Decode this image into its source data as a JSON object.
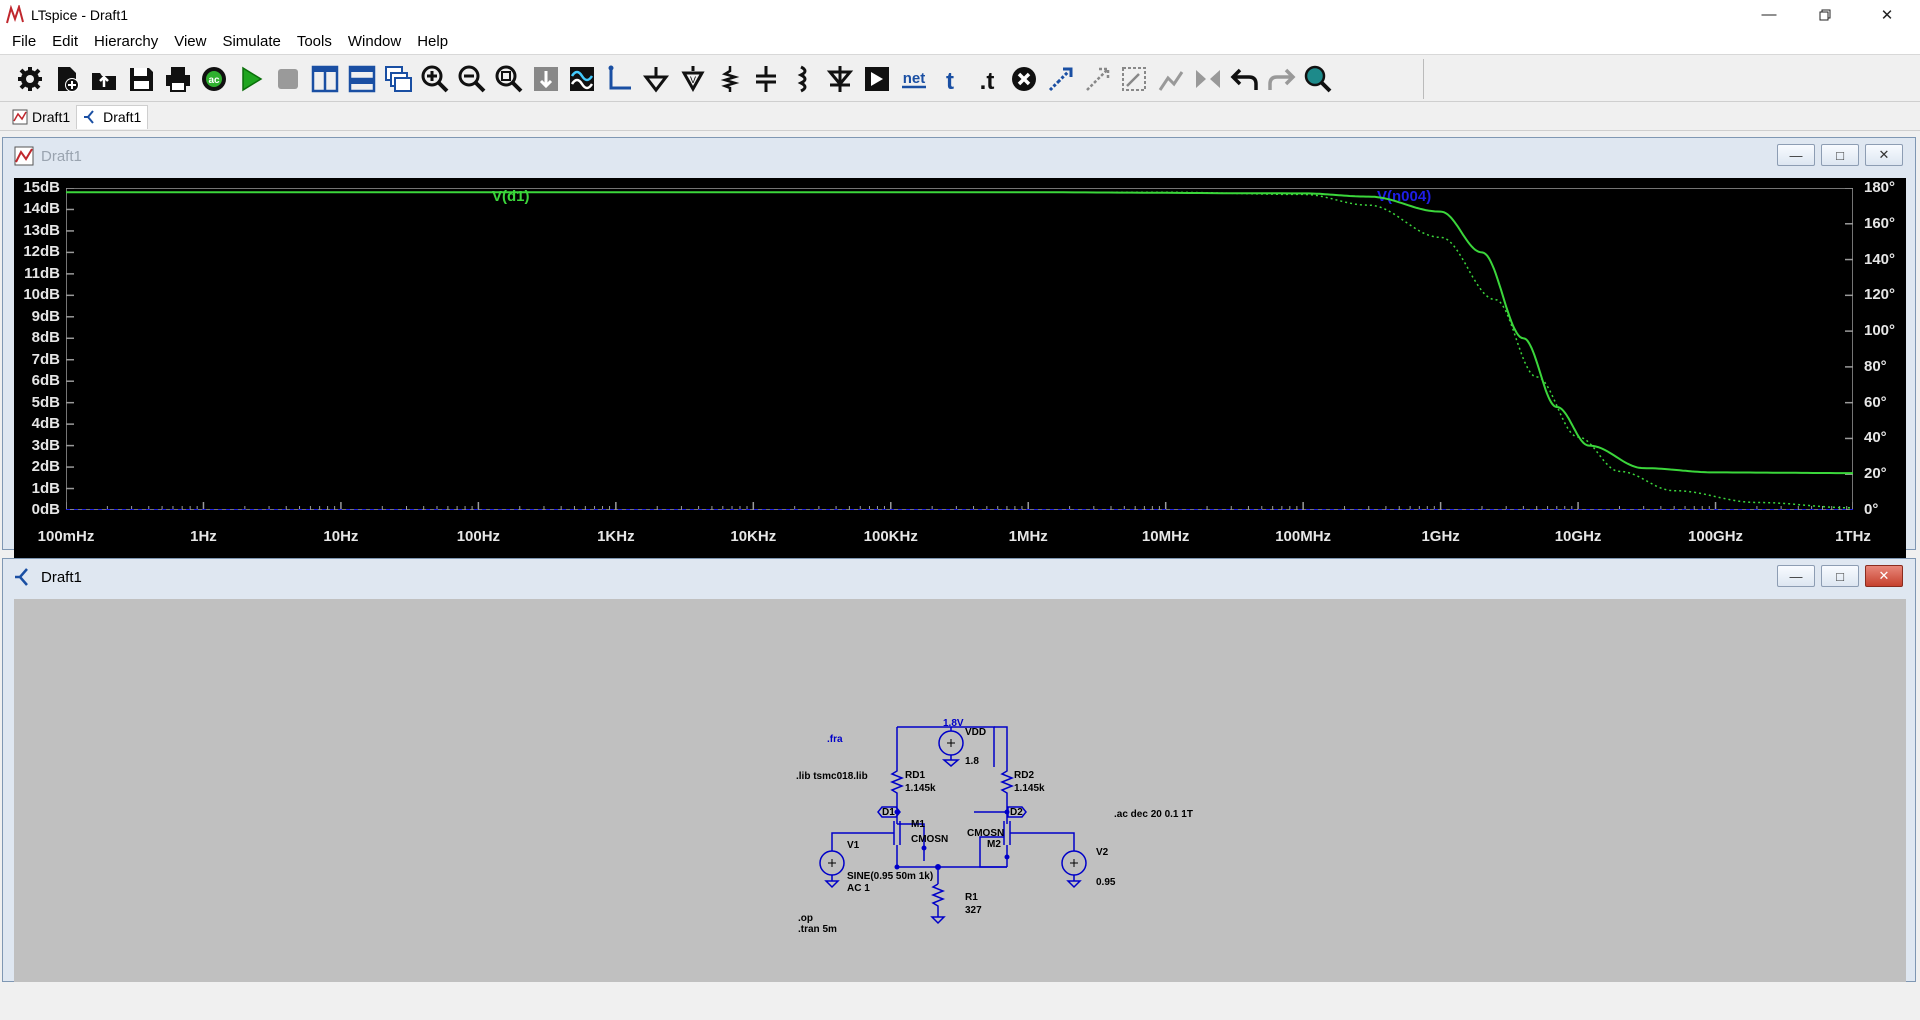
{
  "window": {
    "title": "LTspice - Draft1"
  },
  "menu": [
    "File",
    "Edit",
    "Hierarchy",
    "View",
    "Simulate",
    "Tools",
    "Window",
    "Help"
  ],
  "toolbar": {
    "icons": [
      "settings-icon",
      "new-schematic-icon",
      "open-icon",
      "save-icon",
      "print-icon",
      "control-panel-icon",
      "run-icon",
      "halt-icon",
      "tile-vertical-icon",
      "tile-horizontal-icon",
      "cascade-icon",
      "zoom-in-icon",
      "zoom-out-icon",
      "zoom-fit-icon",
      "autorange-icon",
      "waveform-icon",
      "wire-icon",
      "ground-icon",
      "label-net-icon",
      "resistor-icon",
      "capacitor-icon",
      "inductor-icon",
      "diode-icon",
      "component-icon",
      "net-label-icon",
      "text-icon",
      "spice-directive-icon",
      "delete-icon",
      "duplicate-icon",
      "move-icon",
      "drag-icon",
      "rotate-icon",
      "mirror-icon",
      "undo-icon",
      "redo-icon",
      "find-icon"
    ],
    "net_text": "net",
    "t_text": "t",
    "dot_t_text": ".t",
    "ac_text": "ac"
  },
  "tabs": [
    {
      "label": "Draft1",
      "kind": "waveform"
    },
    {
      "label": "Draft1",
      "kind": "schematic"
    }
  ],
  "waveform_window": {
    "title": "Draft1",
    "trace1": {
      "label": "V(d1)",
      "color": "#3bd63b"
    },
    "trace2": {
      "label": "V(n004)",
      "color": "#1e1ee6"
    }
  },
  "chart_data": {
    "type": "line",
    "x_scale": "log",
    "x_ticks": [
      "100mHz",
      "1Hz",
      "10Hz",
      "100Hz",
      "1KHz",
      "10KHz",
      "100KHz",
      "1MHz",
      "10MHz",
      "100MHz",
      "1GHz",
      "10GHz",
      "100GHz",
      "1THz"
    ],
    "y_left_ticks": [
      "15dB",
      "14dB",
      "13dB",
      "12dB",
      "11dB",
      "10dB",
      "9dB",
      "8dB",
      "7dB",
      "6dB",
      "5dB",
      "4dB",
      "3dB",
      "2dB",
      "1dB",
      "0dB"
    ],
    "y_right_ticks": [
      "180°",
      "160°",
      "140°",
      "120°",
      "100°",
      "80°",
      "60°",
      "40°",
      "20°",
      "0°"
    ],
    "ylim_left": [
      0,
      15
    ],
    "ylim_right": [
      0,
      180
    ],
    "xlim_hz": [
      0.1,
      1000000000000.0
    ],
    "series": [
      {
        "name": "V(d1)",
        "kind": "magnitude_db",
        "points": [
          [
            0.1,
            14.8
          ],
          [
            1000000.0,
            14.8
          ],
          [
            100000000.0,
            14.75
          ],
          [
            300000000.0,
            14.6
          ],
          [
            1000000000.0,
            13.9
          ],
          [
            2000000000.0,
            12.0
          ],
          [
            4000000000.0,
            8.0
          ],
          [
            7000000000.0,
            4.8
          ],
          [
            12000000000.0,
            3.0
          ],
          [
            30000000000.0,
            1.95
          ],
          [
            100000000000.0,
            1.75
          ],
          [
            1000000000000.0,
            1.72
          ]
        ]
      },
      {
        "name": "V(d1)",
        "kind": "phase_dotted",
        "points": [
          [
            0.1,
            14.8
          ],
          [
            10000000.0,
            14.8
          ],
          [
            100000000.0,
            14.7
          ],
          [
            300000000.0,
            14.2
          ],
          [
            1000000000.0,
            12.7
          ],
          [
            2500000000.0,
            9.8
          ],
          [
            5000000000.0,
            6.2
          ],
          [
            10000000000.0,
            3.4
          ],
          [
            20000000000.0,
            1.8
          ],
          [
            50000000000.0,
            0.9
          ],
          [
            200000000000.0,
            0.35
          ],
          [
            1000000000000.0,
            0.1
          ]
        ]
      },
      {
        "name": "V(n004)",
        "kind": "magnitude_db",
        "points": [
          [
            0.1,
            0.0
          ],
          [
            1000000000000.0,
            0.0
          ]
        ]
      }
    ]
  },
  "schematic_window": {
    "title": "Draft1",
    "labels": {
      "fra": ".fra",
      "lib": ".lib tsmc018.lib",
      "v18": "1.8V",
      "vdd": "VDD",
      "vdd_val": "1.8",
      "rd1": "RD1",
      "rd1_val": "1.145k",
      "rd2": "RD2",
      "rd2_val": "1.145k",
      "d1": "D1",
      "d2": "D2",
      "m1": "M1",
      "m1_model": "CMOSN",
      "m2": "M2",
      "m2_model": "CMOSN",
      "v1": "V1",
      "v1_val": "SINE(0.95 50m 1k)",
      "v1_ac": "AC 1",
      "v2": "V2",
      "v2_val": "0.95",
      "r1": "R1",
      "r1_val": "327",
      "ac": ".ac dec 20 0.1 1T",
      "op": ".op",
      "tran": ".tran 5m"
    }
  }
}
